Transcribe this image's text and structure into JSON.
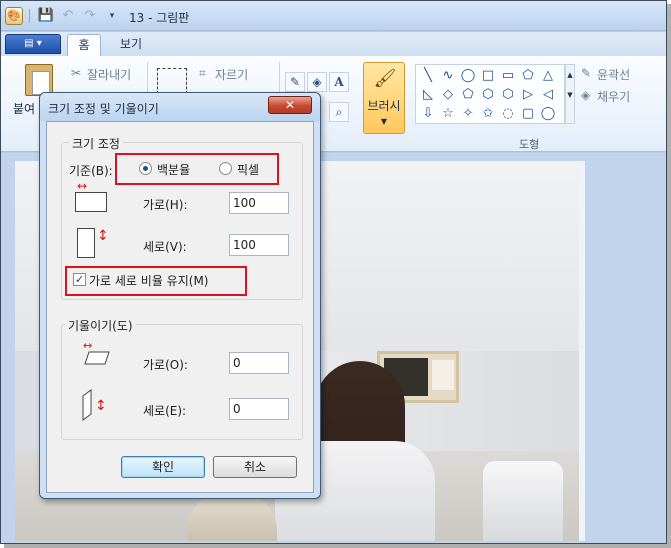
{
  "window": {
    "title": "13 - 그림판"
  },
  "tabs": {
    "home": "홈",
    "view": "보기"
  },
  "ribbon": {
    "paste_partial": "붙여",
    "cut": "잘라내기",
    "crop": "자르기",
    "brushes": "브러시",
    "outline": "윤곽선",
    "fill": "채우기",
    "shapes_group": "도형",
    "text_tool": "A",
    "shapes": [
      "╲",
      "∿",
      "◯",
      "□",
      "▭",
      "⬠",
      "△",
      "◺",
      "◇",
      "⬠",
      "⬡",
      "⬡",
      "▷",
      "◁",
      "⇩",
      "☆",
      "✧",
      "✩",
      "◌",
      "▢",
      "◯"
    ]
  },
  "dialog": {
    "title": "크기 조정 및 기울이기",
    "close_label": "✕",
    "resize": {
      "group_label": "크기 조정",
      "basis_label": "기준(B):",
      "percent_label": "백분율",
      "pixel_label": "픽셀",
      "percent_selected": true,
      "horizontal_label": "가로(H):",
      "horizontal_value": "100",
      "vertical_label": "세로(V):",
      "vertical_value": "100",
      "keep_ratio_label": "가로 세로 비율 유지(M)",
      "keep_ratio_checked": true
    },
    "skew": {
      "group_label": "기울이기(도)",
      "horizontal_label": "가로(O):",
      "horizontal_value": "0",
      "vertical_label": "세로(E):",
      "vertical_value": "0"
    },
    "ok_label": "확인",
    "cancel_label": "취소"
  },
  "colors": {
    "highlight": "#e0101e",
    "title_bar": "#bcd4ef",
    "brush_active": "#ffc95c"
  }
}
